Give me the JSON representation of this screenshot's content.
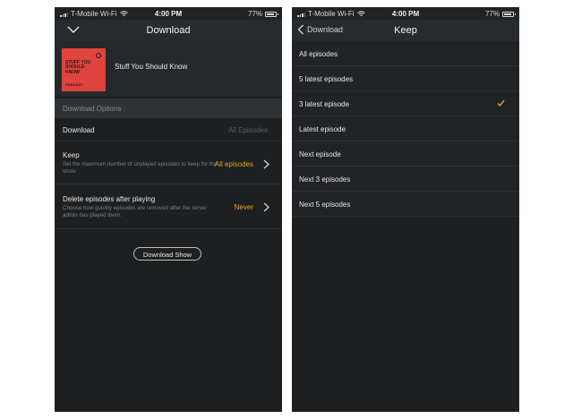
{
  "status": {
    "carrier": "T-Mobile Wi-Fi",
    "time": "4:00 PM",
    "battery": "77%"
  },
  "left": {
    "nav": {
      "title": "Download",
      "icon": "chevron-down-icon"
    },
    "show": {
      "title": "Stuff You Should Know",
      "cover_text": "STUFF YOU SHOULD KNOW",
      "cover_subtext": "PODCAST",
      "cover_color": "#e0443e"
    },
    "section_header": "Download Options",
    "rows": {
      "download": {
        "label": "Download",
        "value": "All Episodes"
      },
      "keep": {
        "label": "Keep",
        "description": "Set the maximum number of unplayed episodes to keep for the show.",
        "value": "All episodes"
      },
      "delete": {
        "label": "Delete episodes after playing",
        "description": "Choose how quickly episodes are removed after the server admin has played them.",
        "value": "Never"
      }
    },
    "download_show_button": "Download Show"
  },
  "right": {
    "nav": {
      "back_label": "Download",
      "title": "Keep"
    },
    "options": [
      {
        "label": "All episodes",
        "selected": false
      },
      {
        "label": "5 latest episodes",
        "selected": false
      },
      {
        "label": "3 latest episode",
        "selected": true
      },
      {
        "label": "Latest episode",
        "selected": false
      },
      {
        "label": "Next episode",
        "selected": false
      },
      {
        "label": "Next 3 episodes",
        "selected": false
      },
      {
        "label": "Next 5 episodes",
        "selected": false
      }
    ]
  },
  "colors": {
    "accent": "#e5a623",
    "background": "#1d1f21",
    "header": "#282b2e"
  }
}
